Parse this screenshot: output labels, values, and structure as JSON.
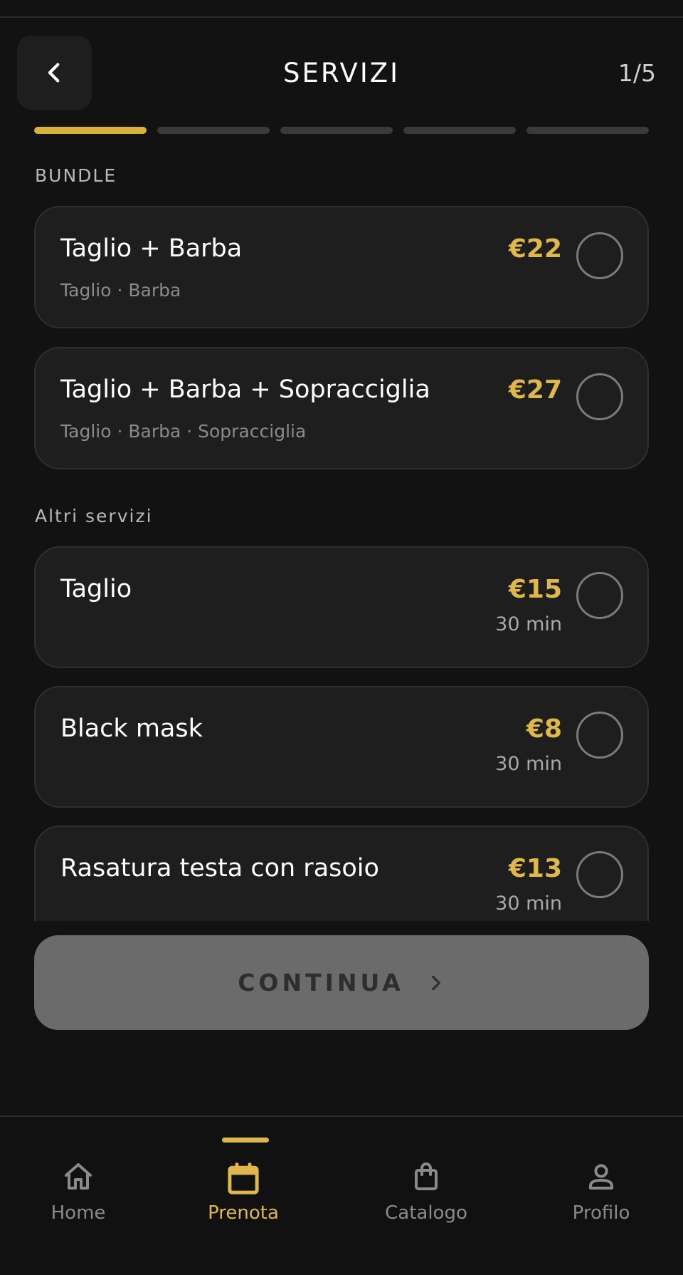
{
  "header": {
    "title": "SERVIZI",
    "step_counter": "1/5"
  },
  "progress": {
    "total_steps": 5,
    "current_step": 1
  },
  "sections": {
    "bundle_label": "BUNDLE",
    "other_label": "Altri servizi"
  },
  "bundles": [
    {
      "name": "Taglio + Barba",
      "includes": "Taglio · Barba",
      "price": "€22",
      "selected": false
    },
    {
      "name": "Taglio + Barba + Sopracciglia",
      "includes": "Taglio · Barba · Sopracciglia",
      "price": "€27",
      "selected": false
    }
  ],
  "services": [
    {
      "name": "Taglio",
      "price": "€15",
      "duration": "30 min",
      "selected": false
    },
    {
      "name": "Black mask",
      "price": "€8",
      "duration": "30 min",
      "selected": false
    },
    {
      "name": "Rasatura testa con rasoio",
      "price": "€13",
      "duration": "30 min",
      "selected": false
    }
  ],
  "continue_button": {
    "label": "CONTINUA",
    "enabled": false
  },
  "bottom_nav": [
    {
      "label": "Home",
      "icon": "home-icon",
      "active": false
    },
    {
      "label": "Prenota",
      "icon": "calendar-icon",
      "active": true
    },
    {
      "label": "Catalogo",
      "icon": "shopping-bag-icon",
      "active": false
    },
    {
      "label": "Profilo",
      "icon": "user-icon",
      "active": false
    }
  ],
  "colors": {
    "background": "#121212",
    "card": "#1e1e1e",
    "accent": "#e0b74a",
    "disabled_button": "#6b6b6b"
  }
}
